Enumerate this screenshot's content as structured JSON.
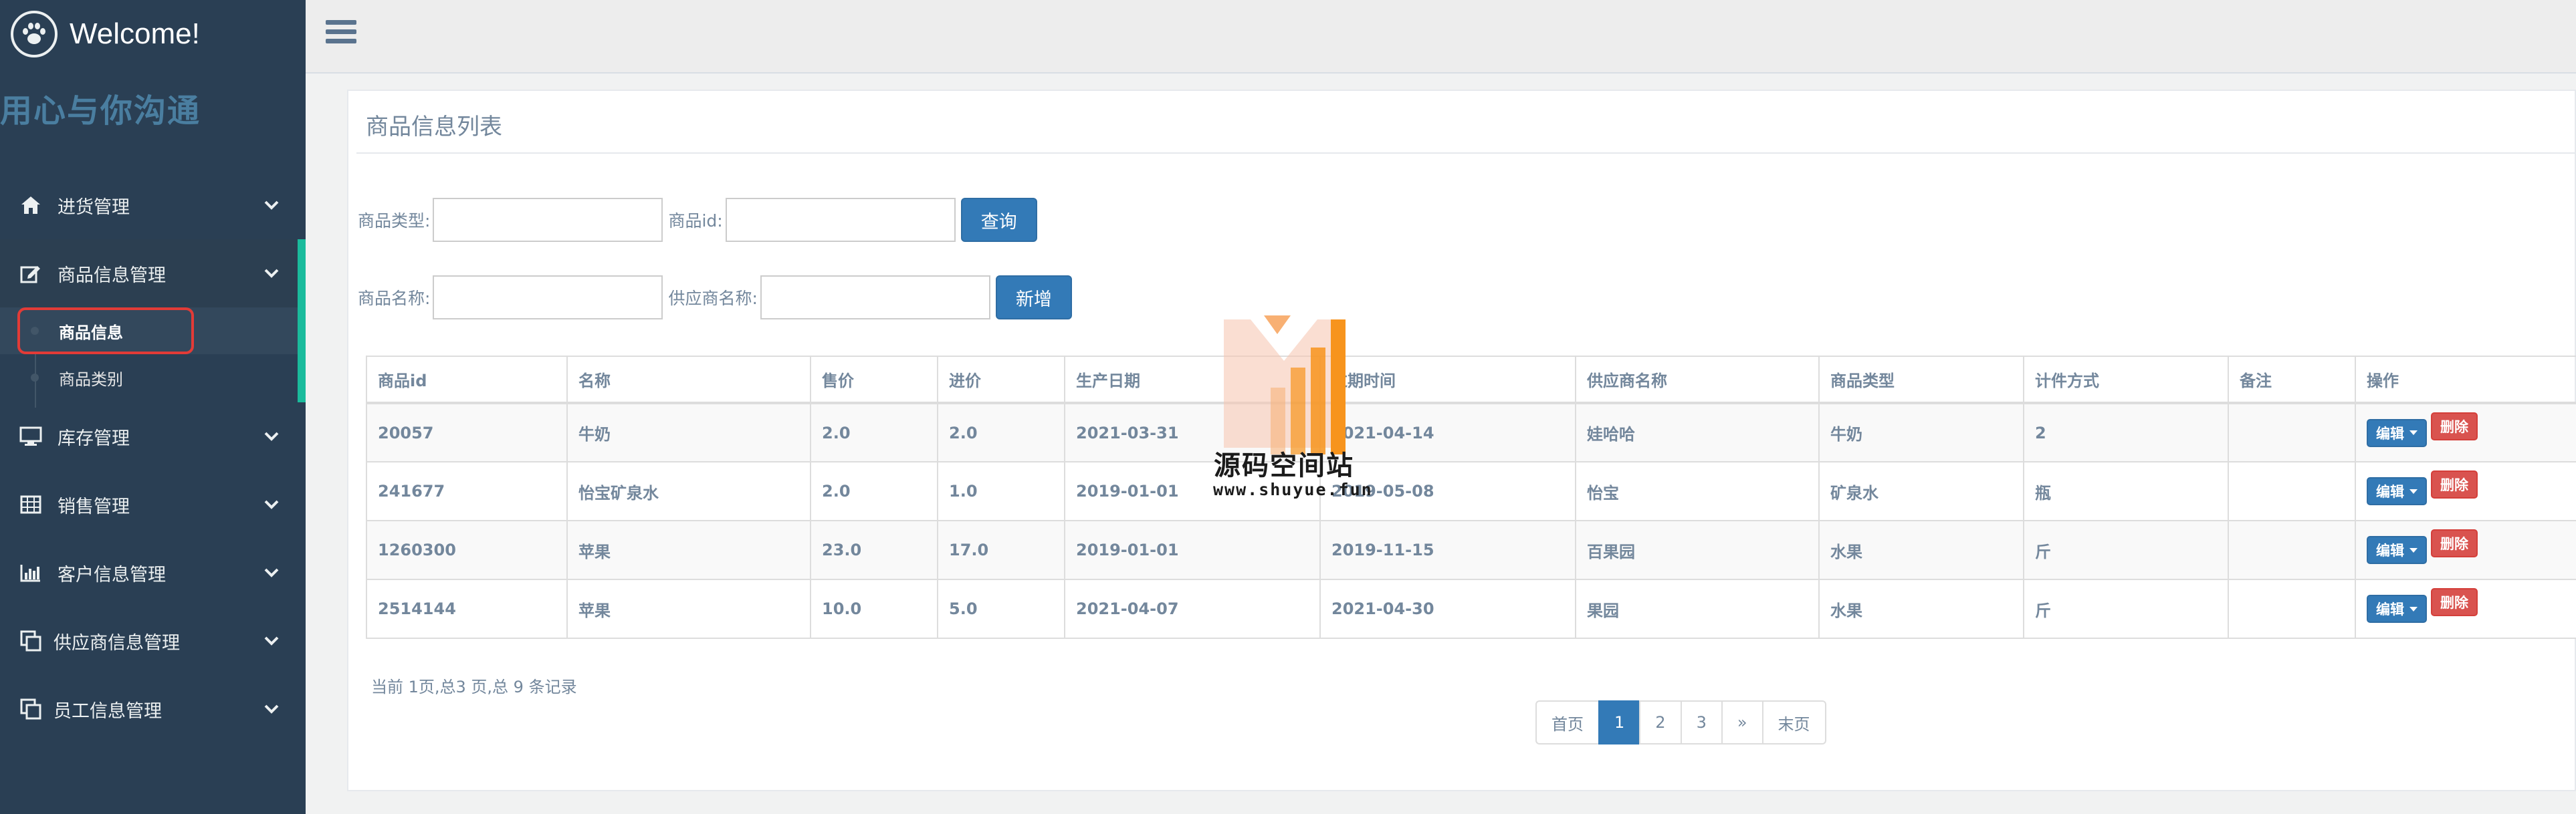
{
  "brand": {
    "title": "Welcome!",
    "slogan": "用心与你沟通"
  },
  "sidebar": {
    "items": [
      {
        "label": "进货管理",
        "icon": "home-icon"
      },
      {
        "label": "商品信息管理",
        "icon": "edit-icon",
        "expanded": true,
        "children": [
          {
            "label": "商品信息",
            "current": true
          },
          {
            "label": "商品类别"
          }
        ]
      },
      {
        "label": "库存管理",
        "icon": "desktop-icon"
      },
      {
        "label": "销售管理",
        "icon": "table-icon"
      },
      {
        "label": "客户信息管理",
        "icon": "bar-chart-icon"
      },
      {
        "label": "供应商信息管理",
        "icon": "clone-icon"
      },
      {
        "label": "员工信息管理",
        "icon": "clone-icon"
      }
    ]
  },
  "panel": {
    "title": "商品信息列表"
  },
  "filters": {
    "type_label": "商品类型:",
    "id_label": "商品id:",
    "name_label": "商品名称:",
    "supplier_label": "供应商名称:",
    "type_value": "",
    "id_value": "",
    "name_value": "",
    "supplier_value": "",
    "query_button": "查询",
    "add_button": "新增"
  },
  "table": {
    "headers": [
      "商品id",
      "名称",
      "售价",
      "进价",
      "生产日期",
      "过期时间",
      "供应商名称",
      "商品类型",
      "计件方式",
      "备注",
      "操作"
    ],
    "rows": [
      [
        "20057",
        "牛奶",
        "2.0",
        "2.0",
        "2021-03-31",
        "2021-04-14",
        "娃哈哈",
        "牛奶",
        "2",
        ""
      ],
      [
        "241677",
        "怡宝矿泉水",
        "2.0",
        "1.0",
        "2019-01-01",
        "2019-05-08",
        "怡宝",
        "矿泉水",
        "瓶",
        ""
      ],
      [
        "1260300",
        "苹果",
        "23.0",
        "17.0",
        "2019-01-01",
        "2019-11-15",
        "百果园",
        "水果",
        "斤",
        ""
      ],
      [
        "2514144",
        "苹果",
        "10.0",
        "5.0",
        "2021-04-07",
        "2021-04-30",
        "果园",
        "水果",
        "斤",
        ""
      ]
    ],
    "edit_label": "编辑",
    "delete_label": "删除"
  },
  "summary": "当前 1页,总3 页,总 9 条记录",
  "pagination": {
    "pages": [
      "首页",
      "1",
      "2",
      "3",
      "»",
      "末页"
    ],
    "current": "1"
  },
  "watermark": {
    "title": "源码空间站",
    "url": "www.shuyue.fun"
  },
  "colors": {
    "sidebar_bg": "#2a3f54",
    "accent_green": "#1abb9c",
    "primary_blue": "#337ab7",
    "danger_red": "#d9534f",
    "highlight_red": "#e23b37"
  }
}
